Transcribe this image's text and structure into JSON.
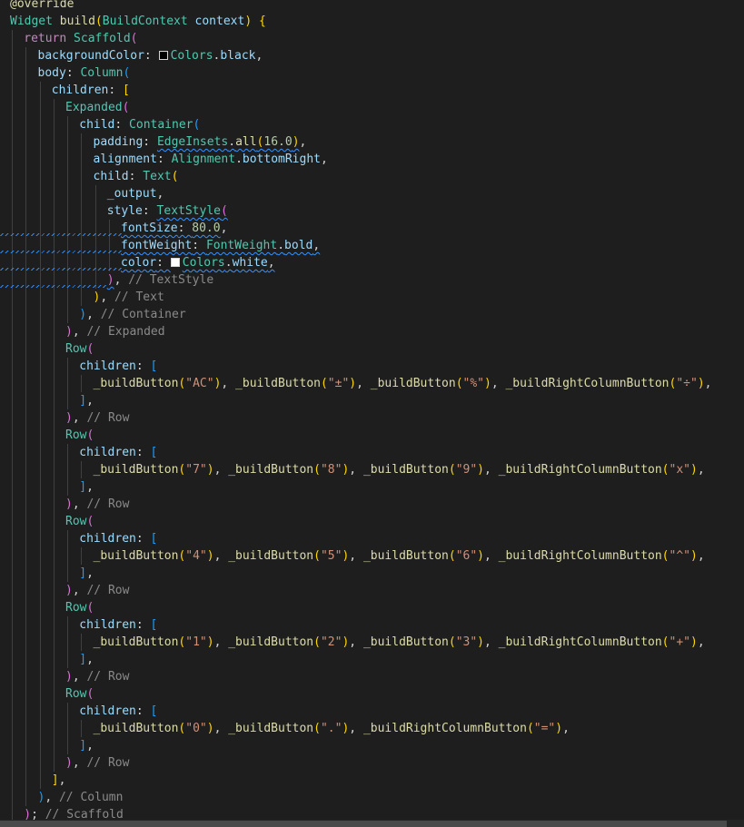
{
  "editor": {
    "theme_background": "#1e1e1e",
    "lines": [
      {
        "indent": 0,
        "tokens": [
          [
            "@override",
            "t-anno"
          ]
        ]
      },
      {
        "indent": 0,
        "tokens": [
          [
            "Widget",
            "t-type"
          ],
          [
            " ",
            "t-pun"
          ],
          [
            "build",
            "t-fn"
          ],
          [
            "(",
            "t-b1"
          ],
          [
            "BuildContext",
            "t-type"
          ],
          [
            " ",
            "t-pun"
          ],
          [
            "context",
            "t-var"
          ],
          [
            ")",
            "t-b1"
          ],
          [
            " ",
            "t-pun"
          ],
          [
            "{",
            "t-b1"
          ]
        ]
      },
      {
        "indent": 1,
        "tokens": [
          [
            "return",
            "t-kw"
          ],
          [
            " ",
            "t-pun"
          ],
          [
            "Scaffold",
            "t-type"
          ],
          [
            "(",
            "t-b2"
          ]
        ]
      },
      {
        "indent": 2,
        "tokens": [
          [
            "backgroundColor",
            "t-var"
          ],
          [
            ": ",
            "t-pun"
          ],
          [
            "@swatch-black",
            ""
          ],
          [
            "Colors",
            "t-type"
          ],
          [
            ".",
            "t-pun"
          ],
          [
            "black",
            "t-var"
          ],
          [
            ",",
            "t-pun"
          ]
        ]
      },
      {
        "indent": 2,
        "tokens": [
          [
            "body",
            "t-var"
          ],
          [
            ": ",
            "t-pun"
          ],
          [
            "Column",
            "t-type"
          ],
          [
            "(",
            "t-b3"
          ]
        ]
      },
      {
        "indent": 3,
        "tokens": [
          [
            "children",
            "t-var"
          ],
          [
            ": ",
            "t-pun"
          ],
          [
            "[",
            "t-b1"
          ]
        ]
      },
      {
        "indent": 4,
        "tokens": [
          [
            "Expanded",
            "t-type"
          ],
          [
            "(",
            "t-b2"
          ]
        ]
      },
      {
        "indent": 5,
        "tokens": [
          [
            "child",
            "t-var"
          ],
          [
            ": ",
            "t-pun"
          ],
          [
            "Container",
            "t-type"
          ],
          [
            "(",
            "t-b3"
          ]
        ]
      },
      {
        "indent": 6,
        "tokens": [
          [
            "padding",
            "t-var"
          ],
          [
            ": ",
            "t-pun"
          ],
          [
            "EdgeInsets",
            "t-type sq"
          ],
          [
            ".",
            "t-pun sq"
          ],
          [
            "all",
            "t-fn sq"
          ],
          [
            "(",
            "t-b1 sq"
          ],
          [
            "16.0",
            "t-num sq"
          ],
          [
            ")",
            "t-b1 sq"
          ],
          [
            ",",
            "t-pun"
          ]
        ]
      },
      {
        "indent": 6,
        "tokens": [
          [
            "alignment",
            "t-var"
          ],
          [
            ": ",
            "t-pun"
          ],
          [
            "Alignment",
            "t-type"
          ],
          [
            ".",
            "t-pun"
          ],
          [
            "bottomRight",
            "t-var"
          ],
          [
            ",",
            "t-pun"
          ]
        ]
      },
      {
        "indent": 6,
        "tokens": [
          [
            "child",
            "t-var"
          ],
          [
            ": ",
            "t-pun"
          ],
          [
            "Text",
            "t-type"
          ],
          [
            "(",
            "t-b1"
          ]
        ]
      },
      {
        "indent": 7,
        "tokens": [
          [
            "_output",
            "t-var"
          ],
          [
            ",",
            "t-pun"
          ]
        ]
      },
      {
        "indent": 7,
        "tokens": [
          [
            "style",
            "t-var"
          ],
          [
            ": ",
            "t-pun"
          ],
          [
            "TextStyle",
            "t-type sq"
          ],
          [
            "(",
            "t-b2 sq"
          ]
        ]
      },
      {
        "indent": 8,
        "squigleft": 134,
        "tokens": [
          [
            "fontSize",
            "t-var sq"
          ],
          [
            ": ",
            "t-pun sq"
          ],
          [
            "80.0",
            "t-num sq"
          ],
          [
            ",",
            "t-pun"
          ]
        ]
      },
      {
        "indent": 8,
        "squigleft": 134,
        "tokens": [
          [
            "fontWeight",
            "t-var sq"
          ],
          [
            ": ",
            "t-pun sq"
          ],
          [
            "FontWeight",
            "t-type sq"
          ],
          [
            ".",
            "t-pun sq"
          ],
          [
            "bold",
            "t-var sq"
          ],
          [
            ",",
            "t-pun sq"
          ]
        ]
      },
      {
        "indent": 8,
        "squigleft": 134,
        "tokens": [
          [
            "color",
            "t-var sq"
          ],
          [
            ": ",
            "t-pun sq"
          ],
          [
            "@swatch-white",
            ""
          ],
          [
            "Colors",
            "t-type sq"
          ],
          [
            ".",
            "t-pun sq"
          ],
          [
            "white",
            "t-var sq"
          ],
          [
            ",",
            "t-pun sq"
          ]
        ]
      },
      {
        "indent": 7,
        "squigleft": 119,
        "tokens": [
          [
            ")",
            "t-b2 sq"
          ],
          [
            ", ",
            "t-pun"
          ],
          [
            "// TextStyle",
            "t-cmt"
          ]
        ]
      },
      {
        "indent": 6,
        "tokens": [
          [
            ")",
            "t-b1"
          ],
          [
            ", ",
            "t-pun"
          ],
          [
            "// Text",
            "t-cmt"
          ]
        ]
      },
      {
        "indent": 5,
        "tokens": [
          [
            ")",
            "t-b3"
          ],
          [
            ", ",
            "t-pun"
          ],
          [
            "// Container",
            "t-cmt"
          ]
        ]
      },
      {
        "indent": 4,
        "tokens": [
          [
            ")",
            "t-b2"
          ],
          [
            ", ",
            "t-pun"
          ],
          [
            "// Expanded",
            "t-cmt"
          ]
        ]
      },
      {
        "indent": 4,
        "tokens": [
          [
            "Row",
            "t-type"
          ],
          [
            "(",
            "t-b2"
          ]
        ]
      },
      {
        "indent": 5,
        "tokens": [
          [
            "children",
            "t-var"
          ],
          [
            ": ",
            "t-pun"
          ],
          [
            "[",
            "t-b3"
          ]
        ]
      },
      {
        "indent": 6,
        "tokens": [
          [
            "_buildButton",
            "t-fn"
          ],
          [
            "(",
            "t-b1"
          ],
          [
            "\"AC\"",
            "t-str"
          ],
          [
            ")",
            "t-b1"
          ],
          [
            ", ",
            "t-pun"
          ],
          [
            "_buildButton",
            "t-fn"
          ],
          [
            "(",
            "t-b1"
          ],
          [
            "\"±\"",
            "t-str"
          ],
          [
            ")",
            "t-b1"
          ],
          [
            ", ",
            "t-pun"
          ],
          [
            "_buildButton",
            "t-fn"
          ],
          [
            "(",
            "t-b1"
          ],
          [
            "\"%\"",
            "t-str"
          ],
          [
            ")",
            "t-b1"
          ],
          [
            ", ",
            "t-pun"
          ],
          [
            "_buildRightColumnButton",
            "t-fn"
          ],
          [
            "(",
            "t-b1"
          ],
          [
            "\"÷\"",
            "t-str"
          ],
          [
            ")",
            "t-b1"
          ],
          [
            ",",
            "t-pun"
          ]
        ]
      },
      {
        "indent": 5,
        "tokens": [
          [
            "]",
            "t-b3"
          ],
          [
            ",",
            "t-pun"
          ]
        ]
      },
      {
        "indent": 4,
        "tokens": [
          [
            ")",
            "t-b2"
          ],
          [
            ", ",
            "t-pun"
          ],
          [
            "// Row",
            "t-cmt"
          ]
        ]
      },
      {
        "indent": 4,
        "tokens": [
          [
            "Row",
            "t-type"
          ],
          [
            "(",
            "t-b2"
          ]
        ]
      },
      {
        "indent": 5,
        "tokens": [
          [
            "children",
            "t-var"
          ],
          [
            ": ",
            "t-pun"
          ],
          [
            "[",
            "t-b3"
          ]
        ]
      },
      {
        "indent": 6,
        "tokens": [
          [
            "_buildButton",
            "t-fn"
          ],
          [
            "(",
            "t-b1"
          ],
          [
            "\"7\"",
            "t-str"
          ],
          [
            ")",
            "t-b1"
          ],
          [
            ", ",
            "t-pun"
          ],
          [
            "_buildButton",
            "t-fn"
          ],
          [
            "(",
            "t-b1"
          ],
          [
            "\"8\"",
            "t-str"
          ],
          [
            ")",
            "t-b1"
          ],
          [
            ", ",
            "t-pun"
          ],
          [
            "_buildButton",
            "t-fn"
          ],
          [
            "(",
            "t-b1"
          ],
          [
            "\"9\"",
            "t-str"
          ],
          [
            ")",
            "t-b1"
          ],
          [
            ", ",
            "t-pun"
          ],
          [
            "_buildRightColumnButton",
            "t-fn"
          ],
          [
            "(",
            "t-b1"
          ],
          [
            "\"x\"",
            "t-str"
          ],
          [
            ")",
            "t-b1"
          ],
          [
            ",",
            "t-pun"
          ]
        ]
      },
      {
        "indent": 5,
        "tokens": [
          [
            "]",
            "t-b3"
          ],
          [
            ",",
            "t-pun"
          ]
        ]
      },
      {
        "indent": 4,
        "tokens": [
          [
            ")",
            "t-b2"
          ],
          [
            ", ",
            "t-pun"
          ],
          [
            "// Row",
            "t-cmt"
          ]
        ]
      },
      {
        "indent": 4,
        "tokens": [
          [
            "Row",
            "t-type"
          ],
          [
            "(",
            "t-b2"
          ]
        ]
      },
      {
        "indent": 5,
        "tokens": [
          [
            "children",
            "t-var"
          ],
          [
            ": ",
            "t-pun"
          ],
          [
            "[",
            "t-b3"
          ]
        ]
      },
      {
        "indent": 6,
        "tokens": [
          [
            "_buildButton",
            "t-fn"
          ],
          [
            "(",
            "t-b1"
          ],
          [
            "\"4\"",
            "t-str"
          ],
          [
            ")",
            "t-b1"
          ],
          [
            ", ",
            "t-pun"
          ],
          [
            "_buildButton",
            "t-fn"
          ],
          [
            "(",
            "t-b1"
          ],
          [
            "\"5\"",
            "t-str"
          ],
          [
            ")",
            "t-b1"
          ],
          [
            ", ",
            "t-pun"
          ],
          [
            "_buildButton",
            "t-fn"
          ],
          [
            "(",
            "t-b1"
          ],
          [
            "\"6\"",
            "t-str"
          ],
          [
            ")",
            "t-b1"
          ],
          [
            ", ",
            "t-pun"
          ],
          [
            "_buildRightColumnButton",
            "t-fn"
          ],
          [
            "(",
            "t-b1"
          ],
          [
            "\"^\"",
            "t-str"
          ],
          [
            ")",
            "t-b1"
          ],
          [
            ",",
            "t-pun"
          ]
        ]
      },
      {
        "indent": 5,
        "tokens": [
          [
            "]",
            "t-b3"
          ],
          [
            ",",
            "t-pun"
          ]
        ]
      },
      {
        "indent": 4,
        "tokens": [
          [
            ")",
            "t-b2"
          ],
          [
            ", ",
            "t-pun"
          ],
          [
            "// Row",
            "t-cmt"
          ]
        ]
      },
      {
        "indent": 4,
        "tokens": [
          [
            "Row",
            "t-type"
          ],
          [
            "(",
            "t-b2"
          ]
        ]
      },
      {
        "indent": 5,
        "tokens": [
          [
            "children",
            "t-var"
          ],
          [
            ": ",
            "t-pun"
          ],
          [
            "[",
            "t-b3"
          ]
        ]
      },
      {
        "indent": 6,
        "tokens": [
          [
            "_buildButton",
            "t-fn"
          ],
          [
            "(",
            "t-b1"
          ],
          [
            "\"1\"",
            "t-str"
          ],
          [
            ")",
            "t-b1"
          ],
          [
            ", ",
            "t-pun"
          ],
          [
            "_buildButton",
            "t-fn"
          ],
          [
            "(",
            "t-b1"
          ],
          [
            "\"2\"",
            "t-str"
          ],
          [
            ")",
            "t-b1"
          ],
          [
            ", ",
            "t-pun"
          ],
          [
            "_buildButton",
            "t-fn"
          ],
          [
            "(",
            "t-b1"
          ],
          [
            "\"3\"",
            "t-str"
          ],
          [
            ")",
            "t-b1"
          ],
          [
            ", ",
            "t-pun"
          ],
          [
            "_buildRightColumnButton",
            "t-fn"
          ],
          [
            "(",
            "t-b1"
          ],
          [
            "\"+\"",
            "t-str"
          ],
          [
            ")",
            "t-b1"
          ],
          [
            ",",
            "t-pun"
          ]
        ]
      },
      {
        "indent": 5,
        "tokens": [
          [
            "]",
            "t-b3"
          ],
          [
            ",",
            "t-pun"
          ]
        ]
      },
      {
        "indent": 4,
        "tokens": [
          [
            ")",
            "t-b2"
          ],
          [
            ", ",
            "t-pun"
          ],
          [
            "// Row",
            "t-cmt"
          ]
        ]
      },
      {
        "indent": 4,
        "tokens": [
          [
            "Row",
            "t-type"
          ],
          [
            "(",
            "t-b2"
          ]
        ]
      },
      {
        "indent": 5,
        "tokens": [
          [
            "children",
            "t-var"
          ],
          [
            ": ",
            "t-pun"
          ],
          [
            "[",
            "t-b3"
          ]
        ]
      },
      {
        "indent": 6,
        "tokens": [
          [
            "_buildButton",
            "t-fn"
          ],
          [
            "(",
            "t-b1"
          ],
          [
            "\"0\"",
            "t-str"
          ],
          [
            ")",
            "t-b1"
          ],
          [
            ", ",
            "t-pun"
          ],
          [
            "_buildButton",
            "t-fn"
          ],
          [
            "(",
            "t-b1"
          ],
          [
            "\".\"",
            "t-str"
          ],
          [
            ")",
            "t-b1"
          ],
          [
            ", ",
            "t-pun"
          ],
          [
            "_buildRightColumnButton",
            "t-fn"
          ],
          [
            "(",
            "t-b1"
          ],
          [
            "\"=\"",
            "t-str"
          ],
          [
            ")",
            "t-b1"
          ],
          [
            ",",
            "t-pun"
          ]
        ]
      },
      {
        "indent": 5,
        "tokens": [
          [
            "]",
            "t-b3"
          ],
          [
            ",",
            "t-pun"
          ]
        ]
      },
      {
        "indent": 4,
        "tokens": [
          [
            ")",
            "t-b2"
          ],
          [
            ", ",
            "t-pun"
          ],
          [
            "// Row",
            "t-cmt"
          ]
        ]
      },
      {
        "indent": 3,
        "tokens": [
          [
            "]",
            "t-b1"
          ],
          [
            ",",
            "t-pun"
          ]
        ]
      },
      {
        "indent": 2,
        "tokens": [
          [
            ")",
            "t-b3"
          ],
          [
            ", ",
            "t-pun"
          ],
          [
            "// Column",
            "t-cmt"
          ]
        ]
      },
      {
        "indent": 1,
        "tokens": [
          [
            ")",
            "t-b2"
          ],
          [
            "; ",
            "t-pun"
          ],
          [
            "// Scaffold",
            "t-cmt"
          ]
        ]
      }
    ]
  }
}
